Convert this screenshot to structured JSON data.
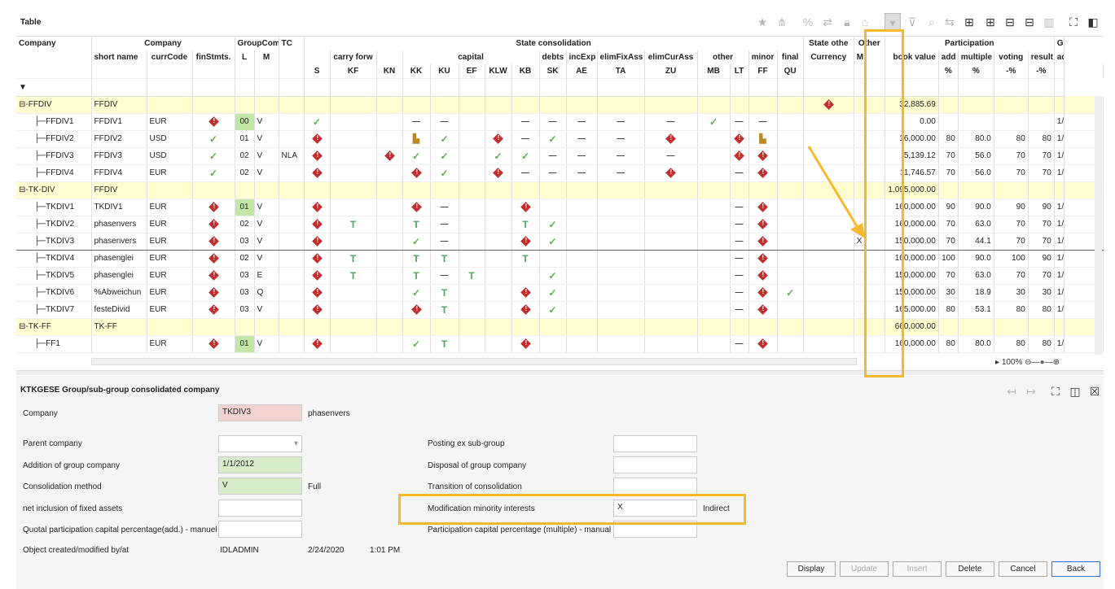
{
  "panel": {
    "title": "Table"
  },
  "grid": {
    "group_headers": [
      "Company",
      "Company",
      "GroupComp",
      "TC",
      "State consolidation",
      "State othe",
      "Other",
      "Participation",
      "Gr"
    ],
    "sub_headers": [
      "short name",
      "currCode",
      "finStmts.",
      "L",
      "M",
      "carry forw",
      "capital",
      "debts",
      "incExp",
      "elimFixAss",
      "elimCurAss",
      "other",
      "minor",
      "final",
      "Currency",
      "M",
      "book value",
      "add",
      "multiple",
      "voting",
      "result",
      "ad"
    ],
    "codes": [
      "S",
      "KF",
      "KN",
      "KK",
      "KU",
      "EF",
      "KLW",
      "KB",
      "SK",
      "AE",
      "TA",
      "ZU",
      "MB",
      "LT",
      "FF",
      "QU"
    ],
    "pct": [
      "%",
      "%",
      "-%",
      "-%"
    ],
    "rows": [
      {
        "type": "group",
        "tree": "⊟-FFDIV",
        "short": "FFDIV",
        "cells": [
          "",
          "",
          "",
          "",
          "",
          "",
          "",
          "",
          "",
          "",
          "",
          "",
          "",
          "",
          "",
          "",
          "",
          "",
          ""
        ],
        "state": "d",
        "other": "",
        "book": "32,885.69",
        "p": [
          "",
          "",
          "",
          "",
          ""
        ]
      },
      {
        "type": "row",
        "tree": "FFDIV1",
        "short": "FFDIV1",
        "curr": "EUR",
        "fin": "d",
        "L": "00",
        "Lg": true,
        "M": "V",
        "TC": "",
        "c": [
          "c",
          "",
          "",
          "-",
          "-",
          "",
          "",
          "-",
          "-",
          "-",
          "-",
          "-",
          "c",
          "-",
          "-",
          ""
        ],
        "other": "",
        "book": "0.00",
        "p": [
          "",
          "",
          "",
          "",
          "1/"
        ]
      },
      {
        "type": "row",
        "tree": "FFDIV2",
        "short": "FFDIV2",
        "curr": "USD",
        "fin": "c",
        "L": "01",
        "Lg": false,
        "M": "V",
        "TC": "",
        "c": [
          "d",
          "",
          "",
          "n",
          "c",
          "",
          "d",
          "-",
          "c",
          "-",
          "-",
          "d",
          "",
          "d",
          "n",
          ""
        ],
        "other": "",
        "book": "16,000.00",
        "p": [
          "80",
          "80.0",
          "80",
          "80",
          "1/"
        ]
      },
      {
        "type": "row",
        "tree": "FFDIV3",
        "short": "FFDIV3",
        "curr": "USD",
        "fin": "c",
        "L": "02",
        "Lg": false,
        "M": "V",
        "TC": "NLA",
        "c": [
          "d",
          "",
          "d",
          "c",
          "c",
          "",
          "c",
          "c",
          "-",
          "-",
          "-",
          "-",
          "",
          "d",
          "d",
          ""
        ],
        "other": "",
        "book": "5,139.12",
        "p": [
          "70",
          "56.0",
          "70",
          "70",
          "1/"
        ]
      },
      {
        "type": "row",
        "tree": "FFDIV4",
        "short": "FFDIV4",
        "curr": "EUR",
        "fin": "c",
        "L": "02",
        "Lg": false,
        "M": "V",
        "TC": "",
        "c": [
          "d",
          "",
          "",
          "d",
          "c",
          "",
          "d",
          "-",
          "-",
          "-",
          "-",
          "d",
          "",
          "-",
          "d",
          ""
        ],
        "other": "",
        "book": "11,746.57",
        "p": [
          "70",
          "56.0",
          "70",
          "70",
          "1/"
        ]
      },
      {
        "type": "group",
        "tree": "⊟-TK-DIV",
        "short": "FFDIV",
        "state": "",
        "other": "",
        "book": "1,095,000.00",
        "p": [
          "",
          "",
          "",
          "",
          ""
        ]
      },
      {
        "type": "row",
        "tree": "TKDIV1",
        "short": "TKDIV1",
        "curr": "EUR",
        "fin": "d",
        "L": "01",
        "Lg": true,
        "M": "V",
        "TC": "",
        "c": [
          "d",
          "",
          "",
          "d",
          "-",
          "",
          "",
          "d",
          "",
          "",
          "",
          "",
          "",
          "-",
          "d",
          ""
        ],
        "other": "",
        "book": "160,000.00",
        "p": [
          "90",
          "90.0",
          "90",
          "90",
          "1/"
        ]
      },
      {
        "type": "row",
        "tree": "TKDIV2",
        "short": "phasenvers",
        "curr": "EUR",
        "fin": "d",
        "L": "02",
        "Lg": false,
        "M": "V",
        "TC": "",
        "c": [
          "d",
          "t",
          "",
          "t",
          "-",
          "",
          "",
          "t",
          "c",
          "",
          "",
          "",
          "",
          "-",
          "d",
          ""
        ],
        "other": "",
        "book": "160,000.00",
        "p": [
          "70",
          "63.0",
          "70",
          "70",
          "1/"
        ]
      },
      {
        "type": "row",
        "sel": true,
        "tree": "TKDIV3",
        "short": "phasenvers",
        "curr": "EUR",
        "fin": "d",
        "L": "03",
        "Lg": false,
        "M": "V",
        "TC": "",
        "c": [
          "d",
          "",
          "",
          "c",
          "-",
          "",
          "",
          "d",
          "c",
          "",
          "",
          "",
          "",
          "-",
          "d",
          ""
        ],
        "other": "X",
        "book": "150,000.00",
        "p": [
          "70",
          "44.1",
          "70",
          "70",
          "1/"
        ]
      },
      {
        "type": "row",
        "tree": "TKDIV4",
        "short": "phasenglei",
        "curr": "EUR",
        "fin": "d",
        "L": "02",
        "Lg": false,
        "M": "V",
        "TC": "",
        "c": [
          "d",
          "t",
          "",
          "t",
          "t",
          "",
          "",
          "t",
          "",
          "",
          "",
          "",
          "",
          "-",
          "d",
          ""
        ],
        "other": "",
        "book": "160,000.00",
        "p": [
          "100",
          "90.0",
          "100",
          "90",
          "1/"
        ]
      },
      {
        "type": "row",
        "tree": "TKDIV5",
        "short": "phasenglei",
        "curr": "EUR",
        "fin": "d",
        "L": "03",
        "Lg": false,
        "M": "E",
        "TC": "",
        "c": [
          "d",
          "t",
          "",
          "t",
          "-",
          "t",
          "",
          "",
          "c",
          "",
          "",
          "",
          "",
          "-",
          "d",
          ""
        ],
        "other": "",
        "book": "150,000.00",
        "p": [
          "70",
          "63.0",
          "70",
          "70",
          "1/"
        ]
      },
      {
        "type": "row",
        "tree": "TKDIV6",
        "short": "%Abweichun",
        "curr": "EUR",
        "fin": "d",
        "L": "03",
        "Lg": false,
        "M": "Q",
        "TC": "",
        "c": [
          "d",
          "",
          "",
          "c",
          "t",
          "",
          "",
          "d",
          "c",
          "",
          "",
          "",
          "",
          "-",
          "d",
          "c"
        ],
        "other": "",
        "book": "150,000.00",
        "p": [
          "30",
          "18.9",
          "30",
          "30",
          "1/"
        ]
      },
      {
        "type": "row",
        "tree": "TKDIV7",
        "short": "festeDivid",
        "curr": "EUR",
        "fin": "d",
        "L": "03",
        "Lg": false,
        "M": "V",
        "TC": "",
        "c": [
          "d",
          "",
          "",
          "d",
          "t",
          "",
          "",
          "d",
          "c",
          "",
          "",
          "",
          "",
          "-",
          "d",
          ""
        ],
        "other": "",
        "book": "165,000.00",
        "p": [
          "80",
          "53.1",
          "80",
          "80",
          "1/"
        ]
      },
      {
        "type": "group",
        "tree": "⊟-TK-FF",
        "short": "TK-FF",
        "state": "",
        "other": "",
        "book": "660,000.00",
        "p": [
          "",
          "",
          "",
          "",
          ""
        ]
      },
      {
        "type": "row",
        "tree": "FF1",
        "short": "",
        "curr": "EUR",
        "fin": "d",
        "L": "01",
        "Lg": true,
        "M": "V",
        "TC": "",
        "c": [
          "d",
          "",
          "",
          "c",
          "t",
          "",
          "",
          "d",
          "",
          "",
          "",
          "",
          "",
          "-",
          "d",
          ""
        ],
        "other": "",
        "book": "160,000.00",
        "p": [
          "80",
          "80.0",
          "80",
          "80",
          "1/"
        ]
      }
    ],
    "zoom": "100%"
  },
  "detail": {
    "title": "KTKGESE Group/sub-group consolidated company",
    "company_label": "Company",
    "company_value": "TKDIV3",
    "company_name": "phasenvers",
    "parent_label": "Parent company",
    "parent_value": "",
    "addition_label": "Addition of  group company",
    "addition_value": "1/1/2012",
    "method_label": "Consolidation method",
    "method_value": "V",
    "method_text": "Full",
    "netinc_label": "net inclusion of fixed assets",
    "netinc_value": "",
    "quotal_label": "Quotal participation capital percentage(add.) - manuel",
    "quotal_value": "",
    "created_label": "Object created/modified by/at",
    "created_user": "IDLADMIN",
    "created_date": "2/24/2020",
    "created_time": "1:01 PM",
    "posting_label": "Posting ex sub-group",
    "posting_value": "",
    "disposal_label": "Disposal of  group company",
    "disposal_value": "",
    "transition_label": "Transition of consolidation",
    "transition_value": "",
    "modif_label": "Modification minority interests",
    "modif_value": "X",
    "modif_text": "Indirect",
    "partcap_label": "Participation capital percentage (multiple) - manual",
    "partcap_value": ""
  },
  "buttons": {
    "display": "Display",
    "update": "Update",
    "insert": "Insert",
    "delete": "Delete",
    "cancel": "Cancel",
    "back": "Back"
  },
  "colors": {
    "highlight": "#f5b82e",
    "group_row": "#fffed0",
    "green_cell": "#c3e6a7",
    "red_field": "#f2d3cf",
    "green_field": "#d7ecc9"
  }
}
